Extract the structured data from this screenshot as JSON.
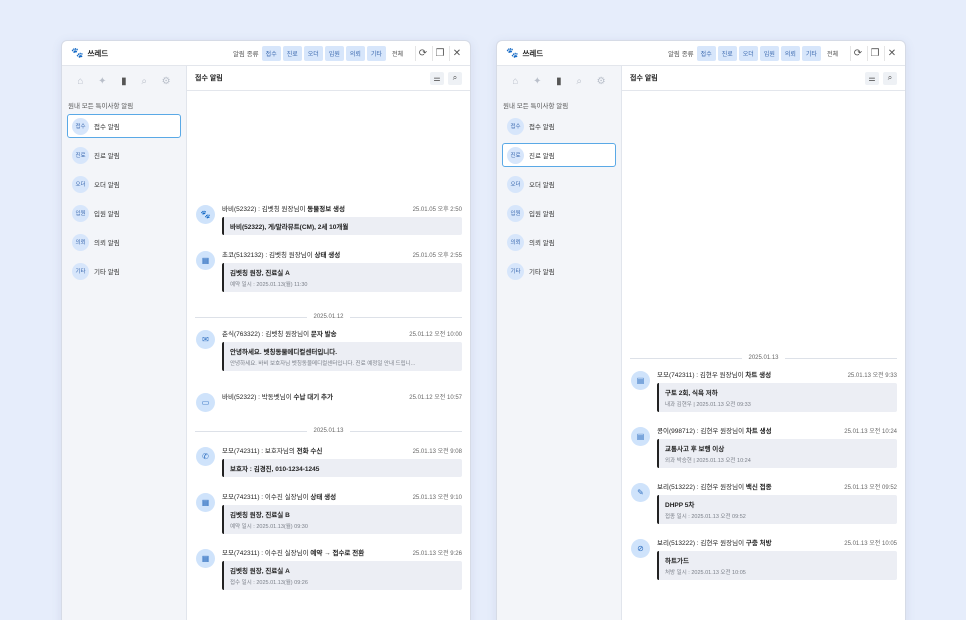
{
  "left": {
    "title": "쓰레드",
    "filter_label": "알림 종류",
    "chips": [
      "접수",
      "진료",
      "오더",
      "입원",
      "의뢰",
      "기타"
    ],
    "all_label": "전체",
    "side_heading": "원내 모든 특이사항 알림",
    "side_items": [
      {
        "badge": "접수",
        "label": "접수 알림"
      },
      {
        "badge": "진료",
        "label": "진료 알림"
      },
      {
        "badge": "오더",
        "label": "오더 알림"
      },
      {
        "badge": "입원",
        "label": "입원 알림"
      },
      {
        "badge": "의뢰",
        "label": "의뢰 알림"
      },
      {
        "badge": "기타",
        "label": "기타 알림"
      }
    ],
    "main_title": "접수 알림",
    "messages": [
      {
        "sender": "바비(52322) : 김벳칭 원장님이 ",
        "action": "동물정보 생성",
        "time": "25.01.05 오후 2:50",
        "box_title": "바비(52322), 게/말라뮤트(CM), 2세 10개월",
        "box_sub": ""
      },
      {
        "sender": "초코(5132132) : 김벳칭 원장님이 ",
        "action": "상태 생성",
        "time": "25.01.05 오후 2:55",
        "box_title": "김벳칭 원장, 진료실 A",
        "box_sub": "예약 일시 : 2025.01.13(월) 11:30"
      },
      {
        "divider": "2025.01.12"
      },
      {
        "sender": "춘식(763322) : 김벳칭 원장님이 ",
        "action": "문자 발송",
        "time": "25.01.12 오전 10:00",
        "box_title": "안녕하세요. 벳칭동물메디컬센터입니다.",
        "box_sub": "안녕하세요. 바비 보호자님 벳칭동물메디컬센터입니다. 진료 예정일 안내 드립니..."
      },
      {
        "sender": "바비(52322) : 박동벳님이 ",
        "action": "수납 대기 추가",
        "time": "25.01.12 오전 10:57"
      },
      {
        "divider": "2025.01.13"
      },
      {
        "sender": "모모(742311) : 보호자님의 ",
        "action": "전화 수신",
        "time": "25.01.13 오전 9:08",
        "box_title": "보호자 : 김경진, 010-1234-1245",
        "box_sub": ""
      },
      {
        "sender": "모모(742311) : 이수진 실장님이 ",
        "action": "상태 생성",
        "time": "25.01.13 오전 9:10",
        "box_title": "김벳칭 원장, 진료실 B",
        "box_sub": "예약 일시 : 2025.01.13(월) 09:30"
      },
      {
        "sender": "모모(742311) : 이수진 실장님이 ",
        "action": "예약 → 접수로 전환",
        "time": "25.01.13 오전 9:26",
        "box_title": "김벳칭 원장, 진료실 A",
        "box_sub": "접수 일시 : 2025.01.13(월) 09:26"
      }
    ]
  },
  "right": {
    "title": "쓰레드",
    "filter_label": "알림 종류",
    "chips": [
      "접수",
      "진료",
      "오더",
      "입원",
      "의뢰",
      "기타"
    ],
    "all_label": "전체",
    "side_heading": "원내 모든 특이사항 알림",
    "side_items": [
      {
        "badge": "접수",
        "label": "접수 알림"
      },
      {
        "badge": "진료",
        "label": "진료 알림"
      },
      {
        "badge": "오더",
        "label": "오더 알림"
      },
      {
        "badge": "입원",
        "label": "입원 알림"
      },
      {
        "badge": "의뢰",
        "label": "의뢰 알림"
      },
      {
        "badge": "기타",
        "label": "기타 알림"
      }
    ],
    "main_title": "접수 알림",
    "messages": [
      {
        "divider": "2025.01.13"
      },
      {
        "sender": "모모(742311) : 김현우 원장님이 ",
        "action": "차트 생성",
        "time": "25.01.13 오전 9:33",
        "box_title": "구토 2회, 식욕 저하",
        "box_sub": "내과 김현우 | 2025.01.13 오전 09:33"
      },
      {
        "sender": "콩이(998712) : 김현우 원장님이 ",
        "action": "차트 생성",
        "time": "25.01.13 오전 10:24",
        "box_title": "교통사고 후 보행 이상",
        "box_sub": "외과 박승현 | 2025.01.13 오전 10:24"
      },
      {
        "sender": "보리(513222) : 김현우 원장님이 ",
        "action": "백신 접종",
        "time": "25.01.13 오전 09:52",
        "box_title": "DHPP 5차",
        "box_sub": "접종 일시 : 2025.01.13 오전 09:52"
      },
      {
        "sender": "보리(513222) : 김현우 원장님이 ",
        "action": "구충 처방",
        "time": "25.01.13 오전 10:05",
        "box_title": "하트가드",
        "box_sub": "처방 일시 : 2025.01.13 오전 10:05"
      }
    ]
  }
}
